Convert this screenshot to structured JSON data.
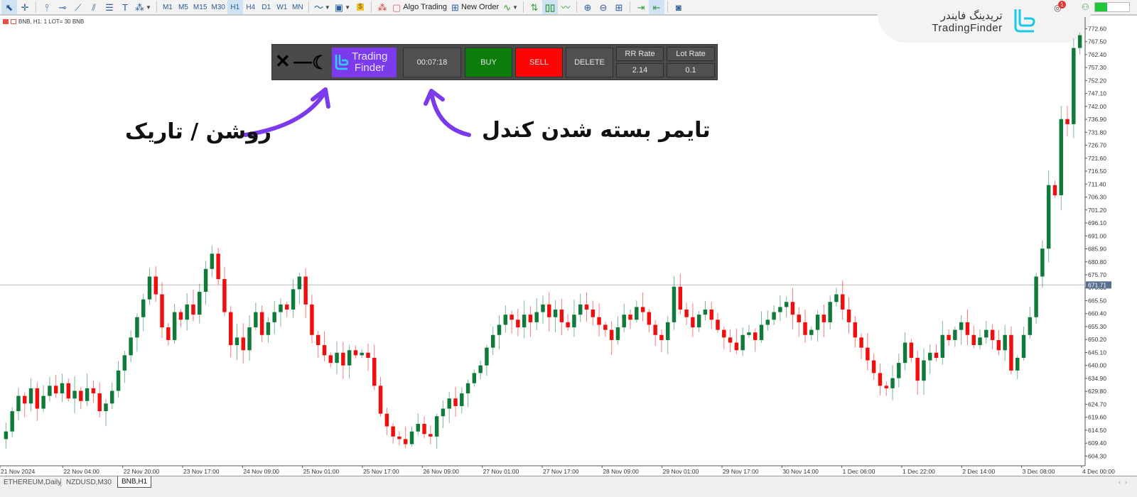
{
  "toolbar": {
    "timeframes": [
      "M1",
      "M5",
      "M15",
      "M30",
      "H1",
      "H4",
      "D1",
      "W1",
      "MN"
    ],
    "active_timeframe": "H1",
    "algo_trading_label": "Algo Trading",
    "new_order_label": "New Order",
    "notification_count": "1",
    "signal_strength": 0.35
  },
  "brand": {
    "name_fa": "تریدینگ فایندر",
    "name_en": "TradingFinder"
  },
  "chart_header": {
    "info": "BNB, H1:  1 LOT= 30 BNB"
  },
  "ea_panel": {
    "close_glyph": "✕",
    "minimize_glyph": "—",
    "theme_glyph": "☾",
    "logo_line1": "Trading",
    "logo_line2": "Finder",
    "timer": "00:07:18",
    "buy_label": "BUY",
    "sell_label": "SELL",
    "delete_label": "DELETE",
    "rr_rate_label": "RR Rate",
    "rr_rate_value": "2.14",
    "lot_rate_label": "Lot Rate",
    "lot_rate_value": "0.1",
    "colors": {
      "buy": "#0b7d0b",
      "sell": "#fb0505",
      "panel": "#4a4a4a",
      "logo_bg": "#7c3aed"
    }
  },
  "annotations": {
    "theme_toggle": "روشن / تاریک",
    "candle_timer": "تایمر بسته شدن کندل",
    "arrow_color": "#7c3aed"
  },
  "tabs": [
    {
      "label": "ETHEREUM,Daily",
      "active": false
    },
    {
      "label": "NZDUSD,M30",
      "active": false
    },
    {
      "label": "BNB,H1",
      "active": true
    }
  ],
  "chart_data": {
    "type": "candlestick",
    "symbol": "BNB",
    "timeframe": "H1",
    "y_ticks": [
      "772.60",
      "767.50",
      "762.40",
      "757.30",
      "752.20",
      "747.10",
      "742.00",
      "736.90",
      "731.80",
      "726.70",
      "721.60",
      "716.50",
      "711.40",
      "706.30",
      "701.20",
      "696.10",
      "691.00",
      "685.90",
      "680.80",
      "675.70",
      "670.60",
      "665.50",
      "660.40",
      "655.30",
      "650.20",
      "645.10",
      "640.00",
      "634.90",
      "629.80",
      "624.70",
      "619.60",
      "614.50",
      "609.40",
      "604.30"
    ],
    "ylim": [
      600.5,
      775.5
    ],
    "x_ticks": [
      "21 Nov 2024",
      "22 Nov 04:00",
      "22 Nov 20:00",
      "23 Nov 17:00",
      "24 Nov 09:00",
      "25 Nov 01:00",
      "25 Nov 17:00",
      "26 Nov 09:00",
      "27 Nov 01:00",
      "27 Nov 17:00",
      "28 Nov 09:00",
      "29 Nov 01:00",
      "29 Nov 17:00",
      "30 Nov 14:00",
      "1 Dec 06:00",
      "1 Dec 22:00",
      "2 Dec 14:00",
      "3 Dec 08:00",
      "4 Dec 00:00"
    ],
    "current_price_label": "671.71",
    "current_price": 671.7,
    "up_color": "#0f7a3a",
    "down_color": "#f20d0d",
    "close_path": [
      614,
      622,
      628,
      625,
      631,
      623,
      628,
      632,
      629,
      633,
      627,
      630,
      626,
      631,
      629,
      622,
      625,
      630,
      638,
      644,
      651,
      659,
      666,
      675,
      668,
      655,
      650,
      661,
      658,
      664,
      660,
      669,
      678,
      684,
      674,
      661,
      648,
      651,
      646,
      655,
      661,
      652,
      657,
      661,
      664,
      662,
      670,
      675,
      664,
      652,
      648,
      644,
      641,
      645,
      640,
      646,
      644,
      645,
      643,
      632,
      621,
      616,
      612,
      611,
      609,
      614,
      617,
      613,
      612,
      620,
      623,
      627,
      624,
      629,
      633,
      637,
      640,
      647,
      652,
      656,
      660,
      658,
      655,
      660,
      657,
      661,
      664,
      659,
      662,
      657,
      655,
      660,
      664,
      662,
      659,
      656,
      654,
      650,
      655,
      660,
      658,
      663,
      661,
      656,
      652,
      650,
      657,
      671,
      662,
      659,
      655,
      660,
      662,
      658,
      654,
      651,
      649,
      646,
      652,
      653,
      650,
      656,
      658,
      661,
      663,
      665,
      660,
      657,
      652,
      654,
      660,
      657,
      665,
      668,
      662,
      657,
      651,
      647,
      642,
      637,
      632,
      631,
      635,
      641,
      649,
      643,
      634,
      642,
      645,
      643,
      652,
      650,
      654,
      657,
      652,
      648,
      651,
      654,
      650,
      646,
      652,
      638,
      643,
      652,
      659,
      675,
      686,
      711,
      707,
      737,
      735,
      765,
      770
    ]
  }
}
